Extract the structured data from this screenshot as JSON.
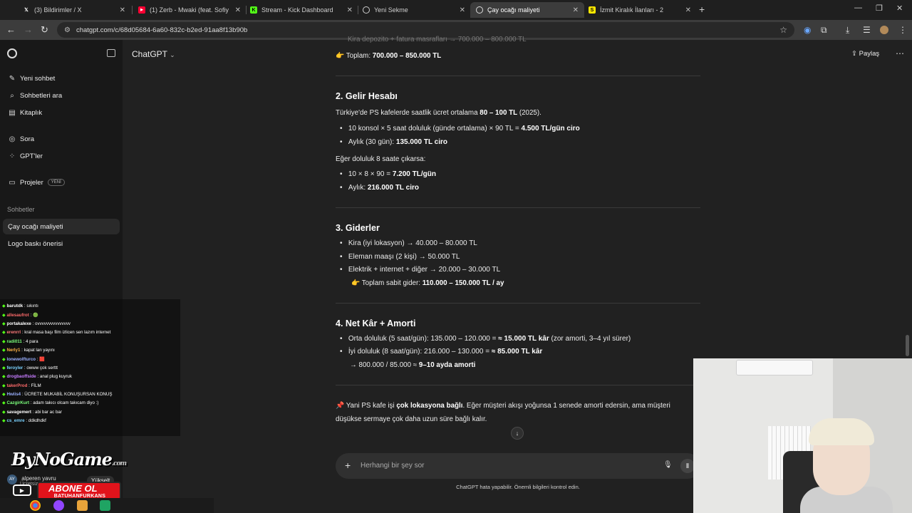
{
  "browser": {
    "tabs": [
      {
        "label": "(3) Bildirimler / X",
        "icon": "x-logo-icon",
        "color": "#ffffff"
      },
      {
        "label": "(1) Zerb - Mwaki (feat. Sofiy",
        "icon": "youtube-icon",
        "color": "#ff0033"
      },
      {
        "label": "Stream - Kick Dashboard",
        "icon": "kick-icon",
        "color": "#53fc18"
      },
      {
        "label": "Yeni Sekme",
        "icon": "globe-icon",
        "color": "#cfcfcf"
      },
      {
        "label": "Çay ocağı maliyeti",
        "icon": "chatgpt-icon",
        "color": "#cfcfcf"
      },
      {
        "label": "İzmit Kiralık İlanları - 2",
        "icon": "sahibinden-icon",
        "color": "#ffe800"
      }
    ],
    "url": "chatgpt.com/c/68d05684-6a60-832c-b2ed-91aa8f13b90b"
  },
  "sidebar": {
    "items": [
      {
        "label": "Yeni sohbet",
        "icon": "edit-icon"
      },
      {
        "label": "Sohbetleri ara",
        "icon": "search-icon"
      },
      {
        "label": "Kitaplık",
        "icon": "library-icon"
      },
      {
        "label": "Sora",
        "icon": "sora-icon"
      },
      {
        "label": "GPT'ler",
        "icon": "grid-icon"
      },
      {
        "label": "Projeler",
        "icon": "folder-icon",
        "badge": "YENİ"
      }
    ],
    "section_label": "Sohbetler",
    "chats": [
      "Çay ocağı maliyeti",
      "Logo baskı önerisi"
    ]
  },
  "header": {
    "app_title": "ChatGPT",
    "share": "Paylaş"
  },
  "message": {
    "cut_line": "Kira depozito + fatura masrafları → 700.000 – 800.000 TL",
    "total_prefix": "Toplam: ",
    "total_value": "700.000 – 850.000 TL",
    "s2_title": "2. Gelir Hesabı",
    "s2_intro_a": "Türkiye'de PS kafelerde saatlik ücret ortalama ",
    "s2_intro_b": "80 – 100 TL",
    "s2_intro_c": " (2025).",
    "s2_b1_a": "10 konsol × 5 saat doluluk (günde ortalama) × 90 TL = ",
    "s2_b1_b": "4.500 TL/gün ciro",
    "s2_b2_a": "Aylık (30 gün): ",
    "s2_b2_b": "135.000 TL ciro",
    "s2_cond": "Eğer doluluk 8 saate çıkarsa:",
    "s2_b3_a": "10 × 8 × 90 = ",
    "s2_b3_b": "7.200 TL/gün",
    "s2_b4_a": "Aylık: ",
    "s2_b4_b": "216.000 TL ciro",
    "s3_title": "3. Giderler",
    "s3_b1": "Kira (iyi lokasyon) → 40.000 – 80.000 TL",
    "s3_b2": "Eleman maaşı (2 kişi) → 50.000 TL",
    "s3_b3": "Elektrik + internet + diğer → 20.000 – 30.000 TL",
    "s3_total_a": "Toplam sabit gider: ",
    "s3_total_b": "110.000 – 150.000 TL / ay",
    "s4_title": "4. Net Kâr + Amorti",
    "s4_b1_a": "Orta doluluk (5 saat/gün): 135.000 – 120.000 = ",
    "s4_b1_b": "≈ 15.000 TL kâr",
    "s4_b1_c": " (zor amorti, 3–4 yıl sürer)",
    "s4_b2_a": "İyi doluluk (8 saat/gün): 216.000 – 130.000 = ",
    "s4_b2_b": "≈ 85.000 TL kâr",
    "s4_b2_cont_a": "→ 800.000 / 85.000 ≈ ",
    "s4_b2_cont_b": "9–10 ayda amorti",
    "conclusion_a": "Yani PS kafe işi ",
    "conclusion_b": "çok lokasyona bağlı",
    "conclusion_c": ". Eğer müşteri akışı yoğunsa 1 senede amorti edersin, ama müşteri",
    "conclusion_d": "düşükse sermaye çok daha uzun süre bağlı kalır."
  },
  "composer": {
    "placeholder": "Herhangi bir şey sor",
    "disclaimer": "ChatGPT hata yapabilir. Önemli bilgileri kontrol edin."
  },
  "stream_chat": [
    {
      "user": "barutdk",
      "text": ": sıkıntı",
      "color": "#ffffff"
    },
    {
      "user": "allesaufrot",
      "text": ": 🟢",
      "color": "#ff6b6b"
    },
    {
      "user": "portakalexe",
      "text": ": ovvvvvvvvvvvvvvv",
      "color": "#ffffff"
    },
    {
      "user": "erenrrl",
      "text": ": kral masa başı film izlicen sen lazım internet",
      "color": "#ff7b7b"
    },
    {
      "user": "radi011",
      "text": ": 4 para",
      "color": "#7bff7b"
    },
    {
      "user": "Nerly1",
      "text": ": kapat lan yayını",
      "color": "#ffb347"
    },
    {
      "user": "lonewolfturco",
      "text": ": 🟥",
      "color": "#9ab0ff"
    },
    {
      "user": "feroyler",
      "text": ": owww çok serttt",
      "color": "#7bd3ff"
    },
    {
      "user": "drogbaoffside",
      "text": ": anal plug kuyruk",
      "color": "#c77dff"
    },
    {
      "user": "takerProd",
      "text": ": FİLM",
      "color": "#ff6b6b"
    },
    {
      "user": "Hwiis4",
      "text": ": ÜCRETE MUKABİL KONUŞURSAN KONUŞ",
      "color": "#9ab0ff"
    },
    {
      "user": "CazgirKurt",
      "text": ": adam takıcı olcam takıcam diyo :)",
      "color": "#7bff7b"
    },
    {
      "user": "savagemert",
      "text": ": abi bar ac bar",
      "color": "#ffffff"
    },
    {
      "user": "cs_emre",
      "text": ": ddkdhdkf",
      "color": "#7bd3ff"
    }
  ],
  "overlay": {
    "logo_text": "ByNoGame",
    "logo_suffix": ".com",
    "subscribe": "ABONE OL",
    "channel": "BATUHANFURKANS",
    "user_initials": "AY",
    "user_name": "alperen yavru",
    "user_plan": "Ücretsiz",
    "upgrade": "Yükselt"
  },
  "colors": {
    "background": "#212121",
    "sidebar": "#181818",
    "accent_red": "#e0131b"
  }
}
